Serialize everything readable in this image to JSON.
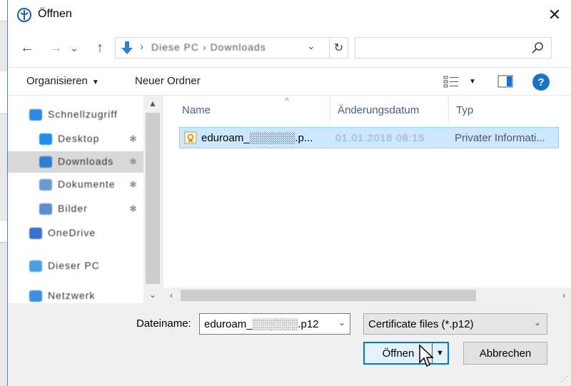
{
  "window": {
    "title": "Öffnen",
    "close_glyph": "✕"
  },
  "nav": {
    "back_glyph": "←",
    "forward_glyph": "→",
    "recent_glyph": "⌄",
    "up_glyph": "↑",
    "address": {
      "separator": "›",
      "crumbs": "Diese PC  ›  Downloads",
      "dropdown_glyph": "⌄",
      "refresh_glyph": "↻"
    },
    "search": {
      "placeholder": ""
    }
  },
  "toolbar": {
    "organize_label": "Organisieren",
    "organize_caret": "▼",
    "new_folder_label": "Neuer Ordner",
    "view_caret": "▼",
    "help_label": "?"
  },
  "sidebar": {
    "items": [
      {
        "label": "Schnellzugriff",
        "icon": "star-icon",
        "color": "#2d8ae0",
        "pinned": false,
        "selected": false
      },
      {
        "label": "Desktop",
        "icon": "desktop-icon",
        "color": "#1f8ee8",
        "pinned": true,
        "selected": false
      },
      {
        "label": "Downloads",
        "icon": "download-icon",
        "color": "#2f7fd1",
        "pinned": true,
        "selected": true
      },
      {
        "label": "Dokumente",
        "icon": "documents-icon",
        "color": "#6b9bd4",
        "pinned": true,
        "selected": false
      },
      {
        "label": "Bilder",
        "icon": "pictures-icon",
        "color": "#5d8fcf",
        "pinned": true,
        "selected": false
      },
      {
        "label": "OneDrive",
        "icon": "cloud-icon",
        "color": "#3a6fd0",
        "pinned": false,
        "selected": false
      },
      {
        "label": "Dieser PC",
        "icon": "computer-icon",
        "color": "#4aa0e6",
        "pinned": false,
        "selected": false
      },
      {
        "label": "Netzwerk",
        "icon": "network-icon",
        "color": "#3d8fe0",
        "pinned": false,
        "selected": false
      }
    ],
    "pin_glyph": "✱",
    "scroll_up": "▲",
    "scroll_down": "⌄"
  },
  "files": {
    "columns": [
      "Name",
      "Änderungsdatum",
      "Typ"
    ],
    "sort_glyph": "^",
    "rows": [
      {
        "name": "eduroam_░░░░░░.p...",
        "modified": "01.01.2018 08:15",
        "type": "Privater Informati...",
        "icon": "certificate-icon"
      }
    ],
    "hscroll_left": "‹",
    "hscroll_right": "›"
  },
  "footer": {
    "filename_label": "Dateiname:",
    "filename_value": "eduroam_░░░░░░.p12",
    "filename_dropdown": "⌄",
    "filter_value": "Certificate files (*.p12)",
    "filter_dropdown": "⌄",
    "open_label": "Öffnen",
    "open_split_glyph": "▼",
    "cancel_label": "Abbrechen",
    "grip": "⋰"
  },
  "colors": {
    "accent": "#0078d7",
    "selection": "#cce8ff",
    "help": "#1a73c9"
  }
}
